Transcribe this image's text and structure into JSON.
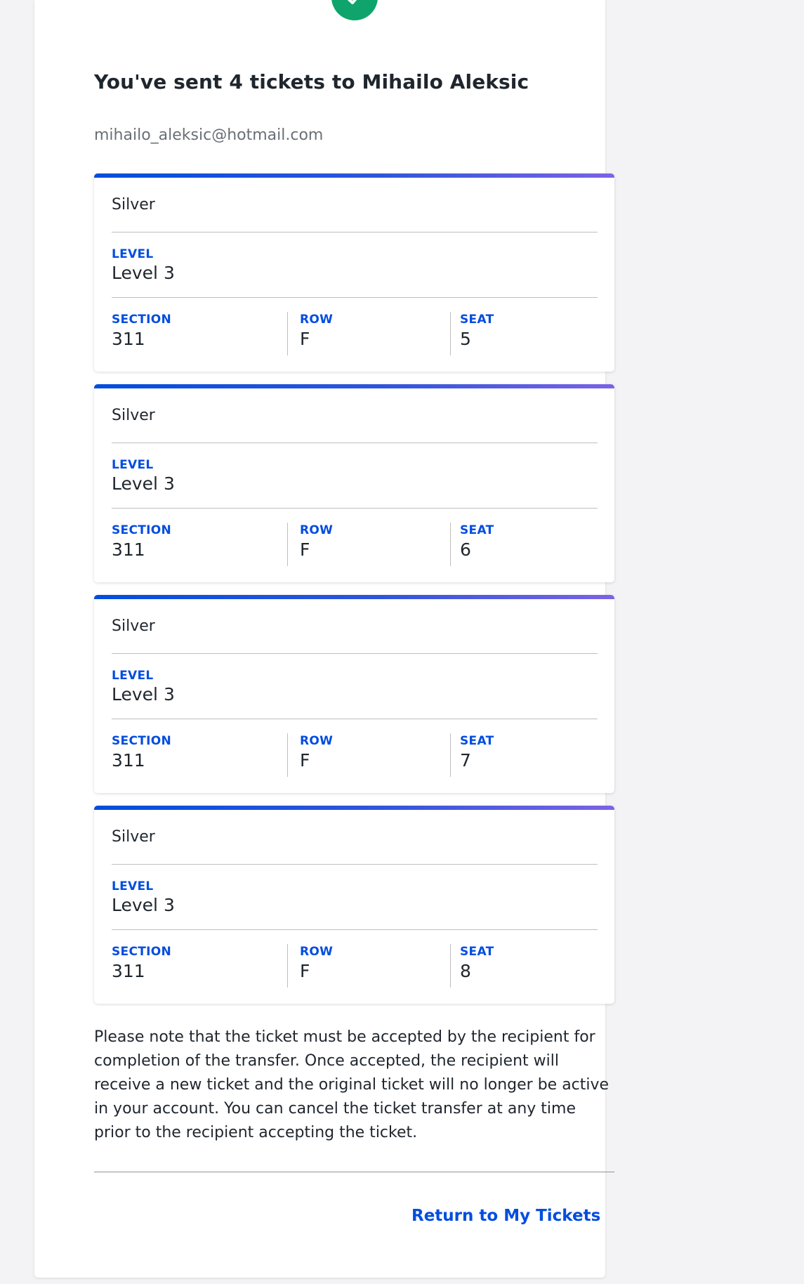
{
  "header": {
    "title": "You've sent 4 tickets to Mihailo Aleksic",
    "email": "mihailo_aleksic@hotmail.com",
    "status_icon": "checkmark-icon",
    "status_color": "#0ea46b"
  },
  "labels": {
    "level": "LEVEL",
    "section": "SECTION",
    "row": "ROW",
    "seat": "SEAT"
  },
  "tickets": [
    {
      "tier": "Silver",
      "level": "Level 3",
      "section": "311",
      "row": "F",
      "seat": "5"
    },
    {
      "tier": "Silver",
      "level": "Level 3",
      "section": "311",
      "row": "F",
      "seat": "6"
    },
    {
      "tier": "Silver",
      "level": "Level 3",
      "section": "311",
      "row": "F",
      "seat": "7"
    },
    {
      "tier": "Silver",
      "level": "Level 3",
      "section": "311",
      "row": "F",
      "seat": "8"
    }
  ],
  "note": "Please note that the ticket must be accepted by the recipient for completion of the transfer. Once accepted, the recipient will receive a new ticket and the original ticket will no longer be active in your account. You can cancel the ticket transfer at any time prior to the recipient accepting the ticket.",
  "actions": {
    "return_label": "Return to My Tickets"
  },
  "colors": {
    "accent": "#024ddf",
    "accent_gradient_end": "#7a63e6"
  }
}
